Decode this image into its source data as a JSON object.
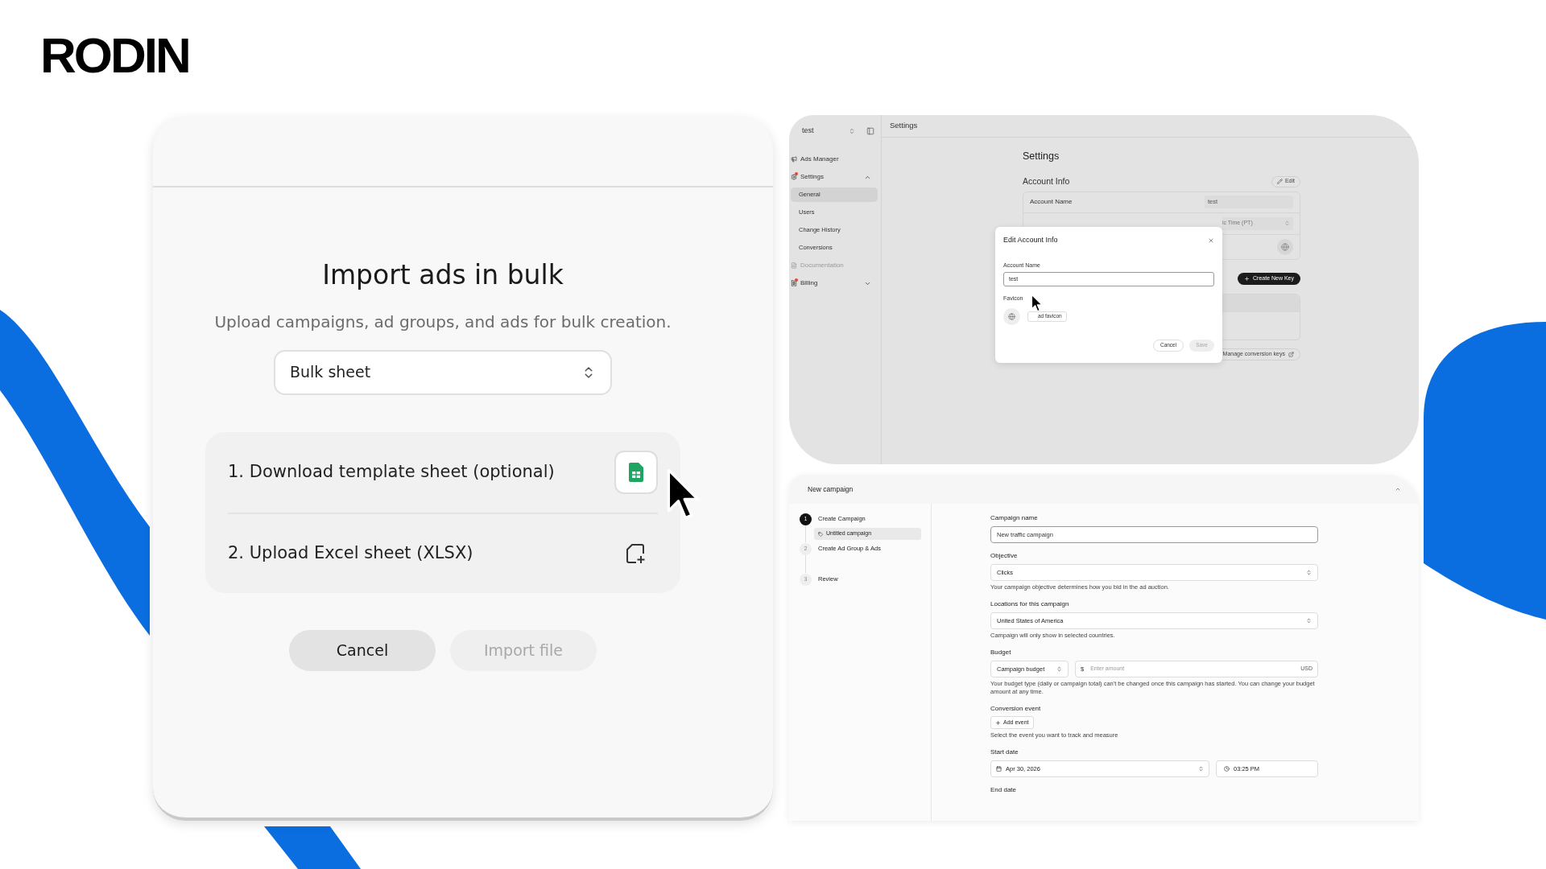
{
  "logo": "RODIN",
  "import_dialog": {
    "title": "Import ads in bulk",
    "subtitle": "Upload campaigns, ad groups, and ads for bulk creation.",
    "select": {
      "value": "Bulk sheet"
    },
    "steps": [
      {
        "label": "1. Download template sheet (optional)",
        "kind": "download"
      },
      {
        "label": "2. Upload Excel sheet (XLSX)",
        "kind": "upload"
      }
    ],
    "buttons": [
      {
        "label": "Cancel",
        "disabled": false
      },
      {
        "label": "Import file",
        "disabled": true
      }
    ]
  },
  "settings_screen": {
    "workspace": "test",
    "header": "Settings",
    "sidebar": [
      {
        "label": "Ads Manager",
        "kind": "link",
        "alert": false,
        "disabled": false
      },
      {
        "label": "Settings",
        "kind": "group",
        "alert": true,
        "disabled": false,
        "expanded": true,
        "children": [
          {
            "label": "General",
            "selected": true
          },
          {
            "label": "Users",
            "selected": false
          },
          {
            "label": "Change History",
            "selected": false
          },
          {
            "label": "Conversions",
            "selected": false
          }
        ]
      },
      {
        "label": "Documentation",
        "kind": "link",
        "alert": false,
        "disabled": true
      },
      {
        "label": "Billing",
        "kind": "group",
        "alert": true,
        "disabled": false,
        "expanded": false
      }
    ],
    "heading": "Settings",
    "section": "Account Info",
    "edit_button": "Edit",
    "account_row": {
      "label": "Account Name",
      "value": "test"
    },
    "timezone": "ic Time (PT)",
    "create_key_button": "Create New Key",
    "manage_keys_button": "Manage conversion keys",
    "modal": {
      "title": "Edit Account Info",
      "name_label": "Account Name",
      "name_value": "test",
      "favicon_label": "Favicon",
      "upload_button": "ad favicon",
      "buttons": [
        {
          "label": "Cancel",
          "disabled": false
        },
        {
          "label": "Save",
          "disabled": true
        }
      ]
    }
  },
  "campaign_screen": {
    "title": "New campaign",
    "steps": [
      {
        "number": "1",
        "label": "Create Campaign",
        "selected": true,
        "children": [
          {
            "label": "Untitled campaign",
            "selected": true
          }
        ]
      },
      {
        "number": "2",
        "label": "Create Ad Group & Ads",
        "selected": false
      },
      {
        "number": "3",
        "label": "Review",
        "selected": false
      }
    ],
    "fields": [
      {
        "kind": "input",
        "label": "Campaign name",
        "value": "New traffic campaign"
      },
      {
        "kind": "select",
        "label": "Objective",
        "value": "Clicks",
        "help": "Your campaign objective determines how you bid in the ad auction."
      },
      {
        "kind": "select",
        "label": "Locations for this campaign",
        "value": "United States of America",
        "help": "Campaign will only show in selected countries."
      },
      {
        "kind": "budget",
        "label": "Budget",
        "value": "Campaign budget",
        "currency": "$",
        "placeholder": "Enter amount",
        "unit": "USD",
        "help": "Your budget type (daily or campaign total) can't be changed once this campaign has started. You can change your budget amount at any time."
      },
      {
        "kind": "button",
        "label": "Conversion event",
        "value": "Add event",
        "help": "Select the event you want to track and measure"
      },
      {
        "kind": "date",
        "label": "Start date",
        "value": "Apr 30, 2026",
        "time": "03:25 PM"
      },
      {
        "kind": "label",
        "label": "End date"
      }
    ]
  }
}
